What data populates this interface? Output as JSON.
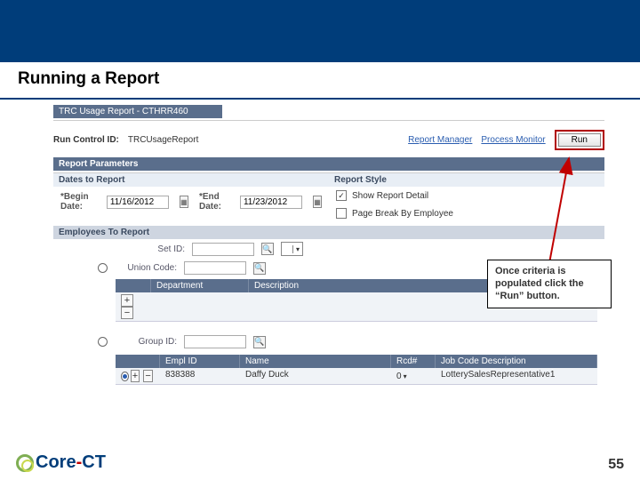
{
  "slide": {
    "title": "Running a Report",
    "page_number": "55"
  },
  "breadcrumb": "TRC Usage Report - CTHRR460",
  "runrow": {
    "label": "Run Control ID:",
    "value": "TRCUsageReport",
    "report_manager": "Report Manager",
    "process_monitor": "Process Monitor",
    "run_btn": "Run"
  },
  "sections": {
    "params": "Report Parameters",
    "dates": "Dates to Report",
    "style": "Report Style",
    "emp": "Employees To Report"
  },
  "dates": {
    "begin_lbl": "*Begin Date:",
    "begin_val": "11/16/2012",
    "end_lbl": "*End Date:",
    "end_val": "11/23/2012"
  },
  "style": {
    "detail": "Show Report Detail",
    "break": "Page Break By Employee"
  },
  "emp": {
    "setid_lbl": "Set ID:",
    "union_lbl": "Union Code:",
    "group_lbl": "Group ID:"
  },
  "dept_grid": {
    "c1": "Department",
    "c2": "Description"
  },
  "emp_grid": {
    "c1": "Empl ID",
    "c2": "Name",
    "c3": "Rcd#",
    "c4": "Job Code Description",
    "r_emplid": "838388",
    "r_name": "Daffy Duck",
    "r_rcd": "0",
    "r_job": "LotterySalesRepresentative1"
  },
  "callout": "Once criteria is populated click the “Run” button.",
  "logo": {
    "core": "Core",
    "ct": "CT"
  }
}
